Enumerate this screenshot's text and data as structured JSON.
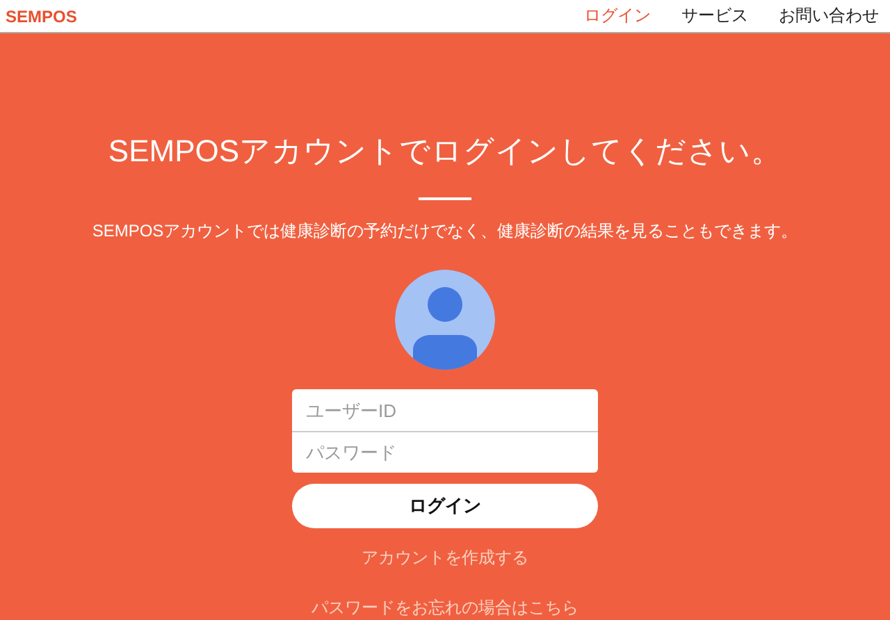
{
  "brand": "SEMPOS",
  "nav": [
    {
      "label": "ログイン",
      "selected": true
    },
    {
      "label": "サービス",
      "selected": false
    },
    {
      "label": "お問い合わせ",
      "selected": false
    }
  ],
  "title": "SEMPOSアカウントでログインしてください。",
  "subtitle": "SEMPOSアカウントでは健康診断の予約だけでなく、健康診断の結果を見ることもできます。",
  "fields": [
    {
      "placeholder": "ユーザーID"
    },
    {
      "placeholder": "パスワード"
    }
  ],
  "login_button": "ログイン",
  "links": [
    "アカウントを作成する",
    "パスワードをお忘れの場合はこちら"
  ]
}
